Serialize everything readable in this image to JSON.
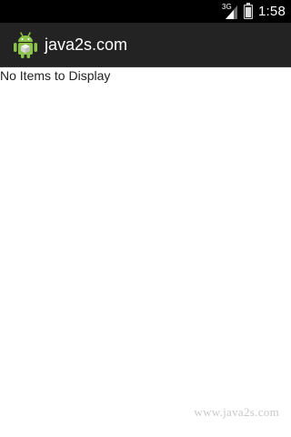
{
  "status_bar": {
    "network_type": "3G",
    "time": "1:58",
    "icons": [
      "signal-icon",
      "battery-icon"
    ]
  },
  "action_bar": {
    "app_icon": "android-icon",
    "title": "java2s.com"
  },
  "content": {
    "empty_message": "No Items to Display"
  },
  "watermark": {
    "text": "www.java2s.com"
  },
  "colors": {
    "status_bar_bg": "#000000",
    "action_bar_bg": "#232323",
    "page_bg": "#ffffff",
    "android_green": "#8bc34a"
  }
}
